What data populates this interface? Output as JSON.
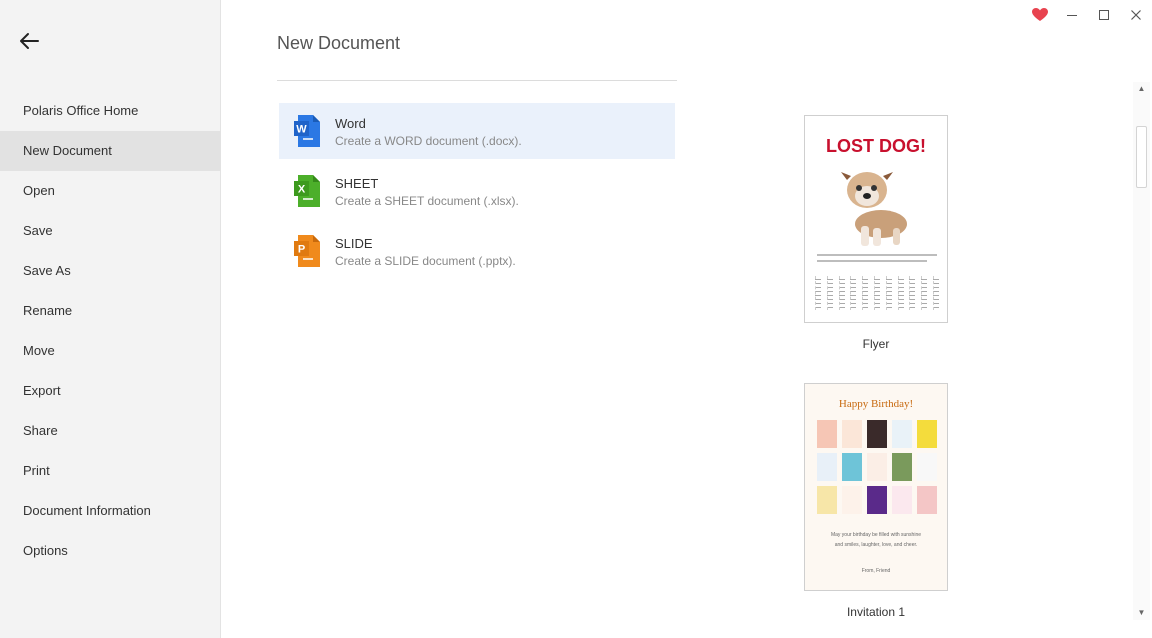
{
  "sidebar": {
    "items": [
      {
        "label": "Polaris Office Home"
      },
      {
        "label": "New Document"
      },
      {
        "label": "Open"
      },
      {
        "label": "Save"
      },
      {
        "label": "Save As"
      },
      {
        "label": "Rename"
      },
      {
        "label": "Move"
      },
      {
        "label": "Export"
      },
      {
        "label": "Share"
      },
      {
        "label": "Print"
      },
      {
        "label": "Document Information"
      },
      {
        "label": "Options"
      }
    ],
    "active": "New Document"
  },
  "main": {
    "title": "New Document",
    "doc_types": [
      {
        "name": "Word",
        "desc": "Create a WORD document (.docx).",
        "icon_letter": "W",
        "color": "#2b78e4"
      },
      {
        "name": "SHEET",
        "desc": "Create a SHEET document (.xlsx).",
        "icon_letter": "X",
        "color": "#4caf2a"
      },
      {
        "name": "SLIDE",
        "desc": "Create a SLIDE document (.pptx).",
        "icon_letter": "P",
        "color": "#f08a1c"
      }
    ]
  },
  "templates": [
    {
      "label": "Flyer",
      "preview_title": "LOST DOG!"
    },
    {
      "label": "Invitation 1",
      "preview_title": "Happy Birthday!",
      "preview_line1": "May your birthday be filled with sunshine",
      "preview_line2": "and smiles, laughter, love, and cheer.",
      "preview_from": "From, Friend"
    }
  ],
  "colors": {
    "heart": "#e8434f",
    "selected_row": "#eaf1fb",
    "active_nav": "#e2e2e2"
  }
}
